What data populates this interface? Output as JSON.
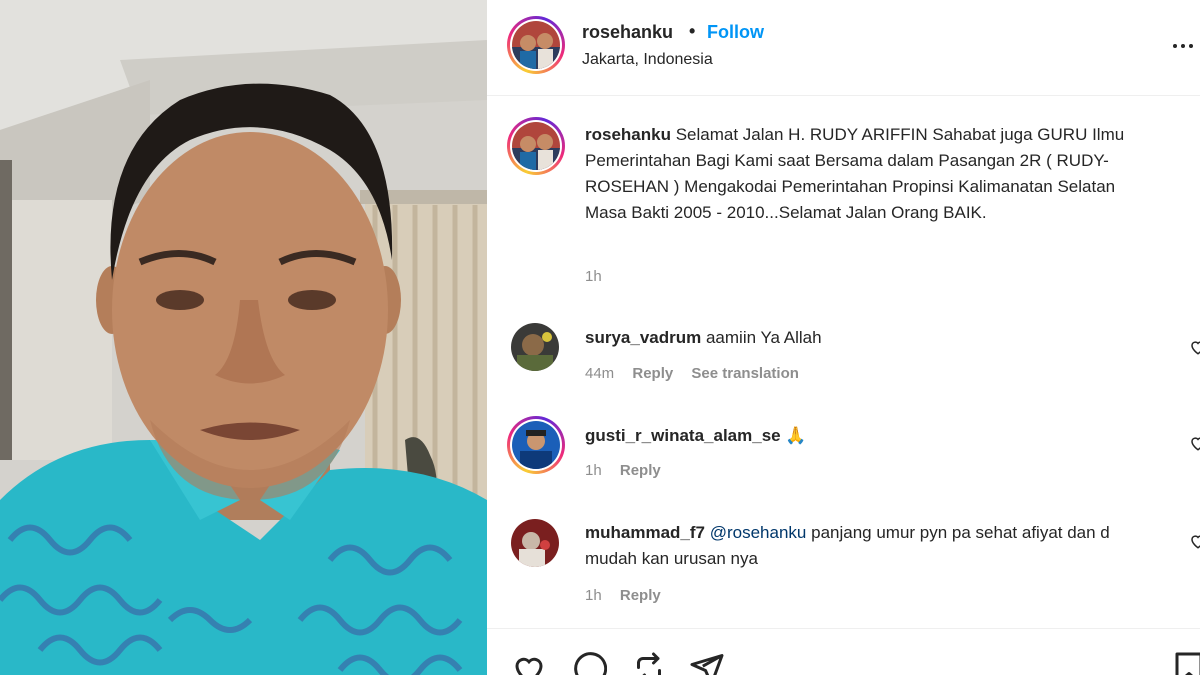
{
  "post": {
    "username": "rosehanku",
    "separator": "•",
    "follow_label": "Follow",
    "location": "Jakarta, Indonesia",
    "caption": {
      "username": "rosehanku",
      "text": "Selamat Jalan H. RUDY ARIFFIN Sahabat juga GURU Ilmu Pemerintahan Bagi Kami saat Bersama dalam Pasangan 2R ( RUDY-ROSEHAN ) Mengakodai Pemerintahan Propinsi Kalimanatan Selatan Masa Bakti 2005 - 2010...Selamat Jalan Orang BAIK.",
      "time": "1h"
    }
  },
  "comments": [
    {
      "username": "surya_vadrum",
      "text": "aamiin Ya Allah",
      "time": "44m",
      "reply_label": "Reply",
      "translate_label": "See translation"
    },
    {
      "username": "gusti_r_winata_alam_se",
      "text": "",
      "emoji": "🙏",
      "time": "1h",
      "reply_label": "Reply"
    },
    {
      "username": "muhammad_f7",
      "mention": "@rosehanku",
      "text": "panjang umur pyn pa sehat afiyat dan d mudah kan urusan nya",
      "time": "1h",
      "reply_label": "Reply"
    }
  ],
  "icons": {
    "more": "more-horizontal-icon",
    "like": "heart-icon",
    "comment": "comment-icon",
    "repost": "repost-icon",
    "share": "share-icon",
    "save": "bookmark-icon"
  },
  "colors": {
    "follow": "#0095f6",
    "secondary_text": "#8e8e8e",
    "shirt": "#29b8c8"
  }
}
